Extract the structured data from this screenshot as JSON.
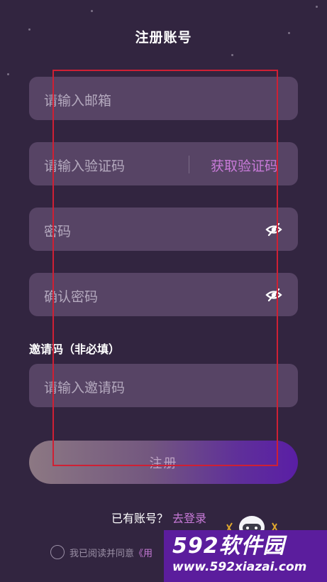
{
  "header": {
    "title": "注册账号"
  },
  "form": {
    "email": {
      "placeholder": "请输入邮箱"
    },
    "verification": {
      "placeholder": "请输入验证码",
      "get_code_label": "获取验证码"
    },
    "password": {
      "placeholder": "密码",
      "toggle_icon": "eye-off-icon"
    },
    "confirm_password": {
      "placeholder": "确认密码",
      "toggle_icon": "eye-off-icon"
    },
    "invite_label": "邀请码（非必填）",
    "invite": {
      "placeholder": "请输入邀请码"
    },
    "register_label": "注册"
  },
  "footer": {
    "have_account": "已有账号？",
    "login_link": "去登录",
    "agree_prefix": "我已阅读并同意",
    "agree_link_partial": "《用"
  },
  "watermark": {
    "brand": "592软件园",
    "url": "www.592xiazai.com"
  },
  "colors": {
    "background": "#322540",
    "field": "#574465",
    "accent": "#c87ad8",
    "button_gradient_end": "#5a1ea5",
    "selection_box": "#cf2034"
  }
}
